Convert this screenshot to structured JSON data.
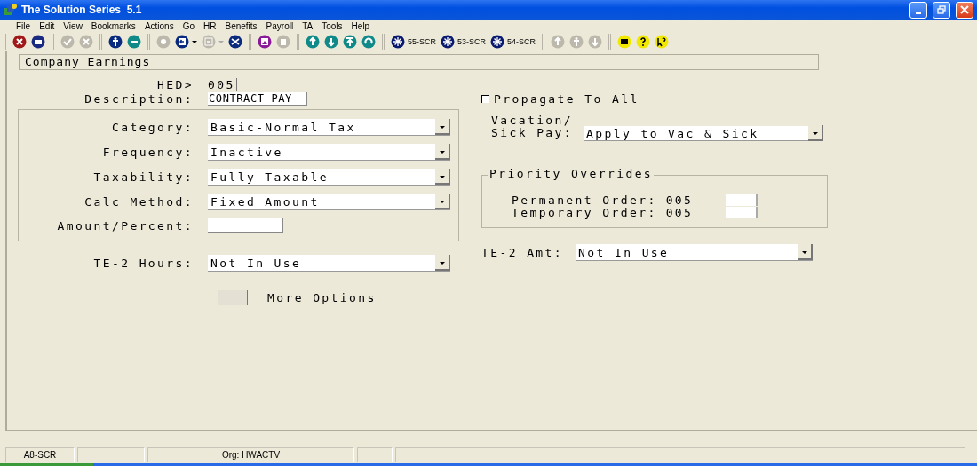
{
  "window": {
    "title": "The Solution Series  5.1"
  },
  "menu": [
    "File",
    "Edit",
    "View",
    "Bookmarks",
    "Actions",
    "Go",
    "HR",
    "Benefits",
    "Payroll",
    "TA",
    "Tools",
    "Help"
  ],
  "toolbar_groups": [
    [
      {
        "kind": "button",
        "disabled": false
      },
      {
        "kind": "button",
        "disabled": false
      }
    ],
    [
      {
        "kind": "button",
        "disabled": true
      },
      {
        "kind": "button",
        "disabled": true
      }
    ],
    [
      {
        "kind": "button",
        "disabled": false
      },
      {
        "kind": "button",
        "disabled": false
      }
    ],
    [
      {
        "kind": "button",
        "disabled": true
      },
      {
        "kind": "split",
        "disabled": false
      },
      {
        "kind": "split",
        "disabled": true
      },
      {
        "kind": "button",
        "disabled": false
      }
    ],
    [
      {
        "kind": "button",
        "disabled": false
      },
      {
        "kind": "button",
        "disabled": true
      }
    ],
    [
      {
        "kind": "button",
        "disabled": false
      },
      {
        "kind": "button",
        "disabled": false
      },
      {
        "kind": "button",
        "disabled": false
      },
      {
        "kind": "button",
        "disabled": false
      }
    ],
    [
      {
        "kind": "button",
        "disabled": false,
        "label": "55-SCR"
      },
      {
        "kind": "button",
        "disabled": false,
        "label": "53-SCR"
      },
      {
        "kind": "button",
        "disabled": false,
        "label": "54-SCR"
      }
    ],
    [
      {
        "kind": "button",
        "disabled": true
      },
      {
        "kind": "button",
        "disabled": true
      },
      {
        "kind": "button",
        "disabled": true
      }
    ],
    [
      {
        "kind": "button",
        "disabled": false
      },
      {
        "kind": "button",
        "disabled": false
      },
      {
        "kind": "button",
        "disabled": false
      }
    ]
  ],
  "screen_title": "Company Earnings",
  "hed": {
    "label": "HED>",
    "value": "005"
  },
  "description": {
    "label": "Description:",
    "value": "CONTRACT PAY"
  },
  "propagate": {
    "label": "Propagate To All",
    "checked": false
  },
  "main_fields": [
    {
      "kind": "dropdown",
      "label": "Category:",
      "value": "Basic-Normal Tax"
    },
    {
      "kind": "dropdown",
      "label": "Frequency:",
      "value": "Inactive"
    },
    {
      "kind": "dropdown",
      "label": "Taxability:",
      "value": "Fully Taxable"
    },
    {
      "kind": "dropdown",
      "label": "Calc Method:",
      "value": "Fixed Amount"
    },
    {
      "kind": "input",
      "label": "Amount/Percent:"
    }
  ],
  "vacation_sick": {
    "label_lines": [
      "Vacation/",
      "Sick Pay:"
    ],
    "value": "Apply to Vac & Sick"
  },
  "priority_overrides": {
    "title": "Priority Overrides",
    "rows": [
      {
        "label": "Permanent Order:",
        "value": "005"
      },
      {
        "label": "Temporary Order:",
        "value": "005"
      }
    ]
  },
  "te2_hours": {
    "label": "TE-2 Hours:",
    "value": "Not In Use"
  },
  "te2_amt": {
    "label": "TE-2 Amt:",
    "value": "Not In Use"
  },
  "more_options": {
    "label": "More Options"
  },
  "status_bar": {
    "screen": "A8-SCR",
    "org": "Org: HWACTV"
  }
}
